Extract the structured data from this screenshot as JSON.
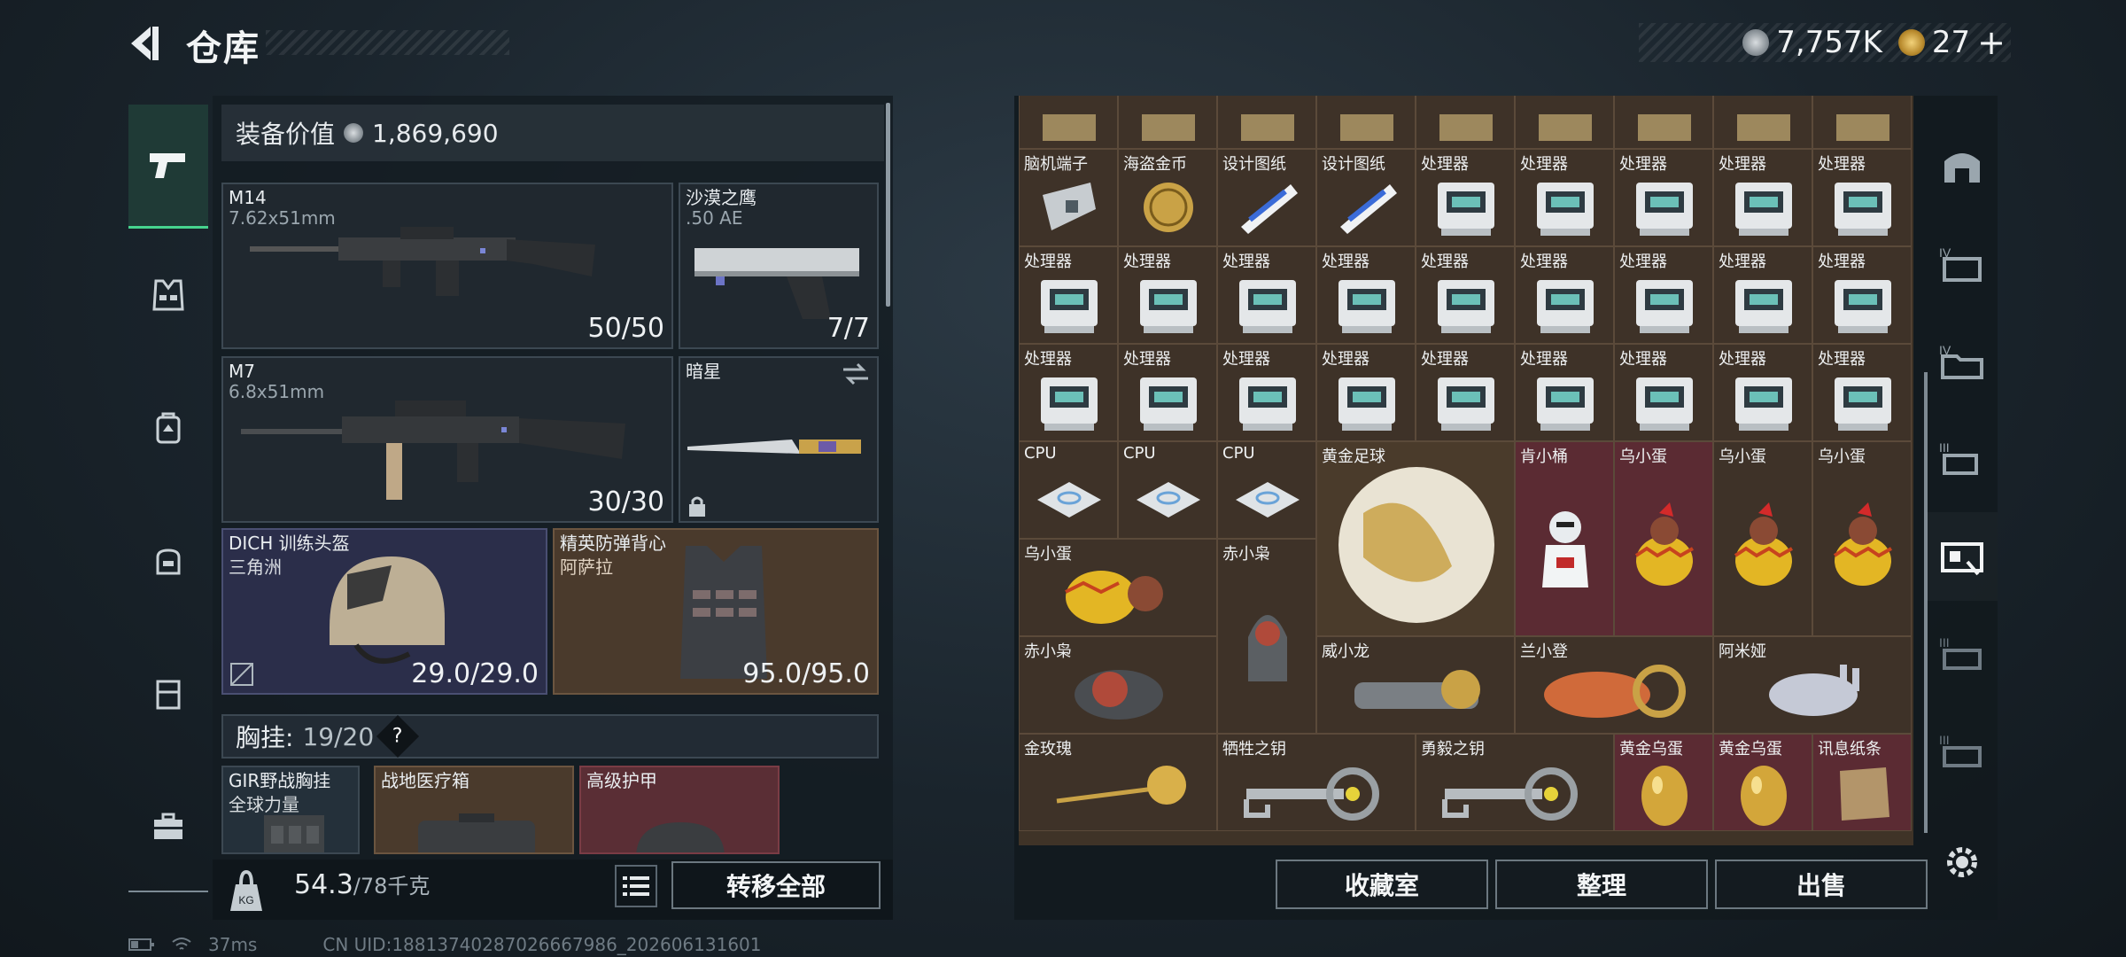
{
  "header": {
    "title": "仓库",
    "currency_main": "7,757K",
    "currency_secondary": "27",
    "plus": "+"
  },
  "loadout": {
    "equip_value_label": "装备价值",
    "equip_value": "1,869,690",
    "primary": {
      "name": "M14",
      "caliber": "7.62x51mm",
      "ammo": "50/50"
    },
    "pistol": {
      "name": "沙漠之鹰",
      "caliber": ".50 AE",
      "ammo": "7/7"
    },
    "secondary": {
      "name": "M7",
      "caliber": "6.8x51mm",
      "ammo": "30/30"
    },
    "melee": {
      "name": "暗星"
    },
    "helmet": {
      "name": "DICH 训练头盔",
      "sub": "三角洲",
      "durability": "29.0/29.0"
    },
    "armor": {
      "name": "精英防弹背心",
      "sub": "阿萨拉",
      "durability": "95.0/95.0"
    },
    "chest_rig": {
      "label": "胸挂:",
      "capacity": "19/20",
      "help": "?"
    },
    "rig": {
      "name": "GIR野战胸挂",
      "sub": "全球力量"
    },
    "medkit": {
      "name": "战地医疗箱"
    },
    "plate": {
      "name": "高级护甲"
    },
    "weight": {
      "current": "54.3",
      "max": "/78千克"
    },
    "transfer_all": "转移全部"
  },
  "storage": {
    "rows": [
      [
        "",
        "",
        "",
        "",
        "",
        "",
        "",
        "",
        ""
      ],
      [
        "脑机端子",
        "海盗金币",
        "设计图纸",
        "设计图纸",
        "处理器",
        "处理器",
        "处理器",
        "处理器",
        "处理器"
      ],
      [
        "处理器",
        "处理器",
        "处理器",
        "处理器",
        "处理器",
        "处理器",
        "处理器",
        "处理器",
        "处理器"
      ],
      [
        "处理器",
        "处理器",
        "处理器",
        "处理器",
        "处理器",
        "处理器",
        "处理器",
        "处理器",
        "处理器"
      ]
    ],
    "row4": [
      "CPU",
      "CPU",
      "CPU",
      "黄金足球",
      "肯小桶",
      "乌小蛋",
      "乌小蛋",
      "乌小蛋"
    ],
    "row5": [
      "乌小蛋",
      "赤小枭"
    ],
    "row6": [
      "赤小枭",
      "威小龙",
      "兰小登",
      "阿米娅"
    ],
    "row7": [
      "金玫瑰",
      "牺牲之钥",
      "勇毅之钥",
      "黄金乌蛋",
      "黄金乌蛋",
      "讯息纸条"
    ]
  },
  "buttons": {
    "collection": "收藏室",
    "sort": "整理",
    "sell": "出售"
  },
  "status": {
    "ping": "37ms",
    "uid": "CN UID:18813740287026667986_202606131601"
  },
  "colors": {
    "accent_green": "#46d38e",
    "cell_brown": "#3e3228",
    "cell_red": "#5b2b33",
    "helmet_slot": "#2b2e4a",
    "armor_slot": "#4a3a2c"
  }
}
